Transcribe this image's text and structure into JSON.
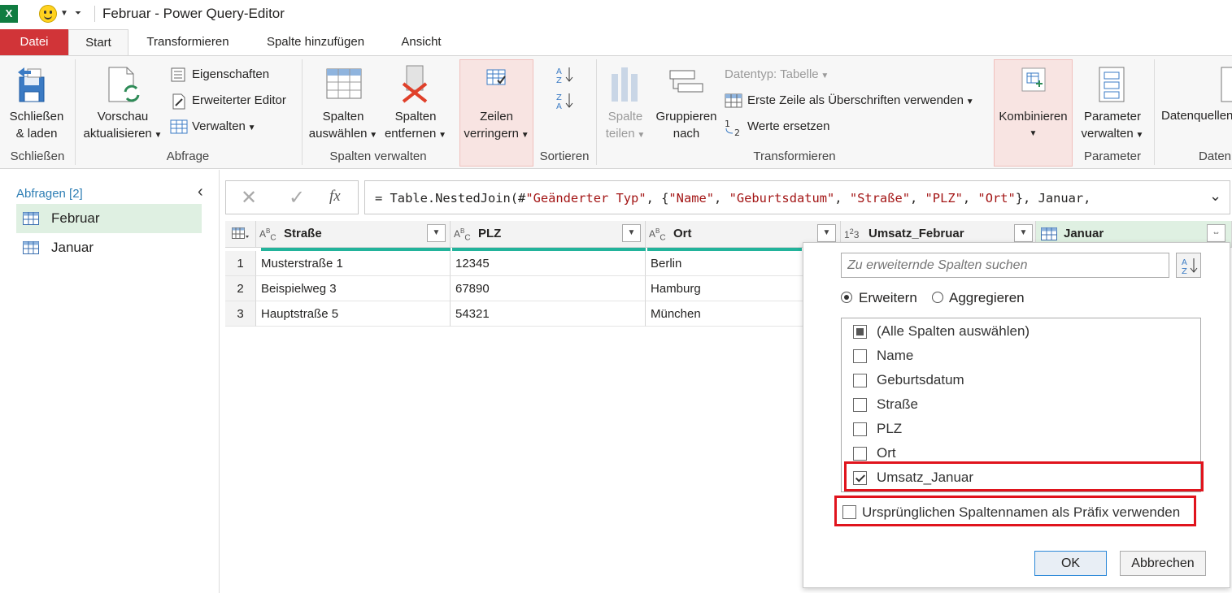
{
  "window": {
    "title": "Februar - Power Query-Editor",
    "app_logo": "X"
  },
  "tabs": [
    "Datei",
    "Start",
    "Transformieren",
    "Spalte hinzufügen",
    "Ansicht"
  ],
  "ribbon": {
    "close_load": {
      "line1": "Schließen",
      "line2": "& laden"
    },
    "refresh_preview": {
      "line1": "Vorschau",
      "line2": "aktualisieren"
    },
    "properties": "Eigenschaften",
    "advanced_editor": "Erweiterter Editor",
    "manage": "Verwalten",
    "choose_columns": {
      "line1": "Spalten",
      "line2": "auswählen"
    },
    "remove_columns": {
      "line1": "Spalten",
      "line2": "entfernen"
    },
    "reduce_rows": {
      "line1": "Zeilen",
      "line2": "verringern"
    },
    "split_column": {
      "line1": "Spalte",
      "line2": "teilen"
    },
    "group_by": {
      "line1": "Gruppieren",
      "line2": "nach"
    },
    "data_type": "Datentyp: Tabelle",
    "first_row_headers": "Erste Zeile als Überschriften verwenden",
    "replace_values": "Werte ersetzen",
    "combine": "Kombinieren",
    "manage_parameters": {
      "line1": "Parameter",
      "line2": "verwalten"
    },
    "data_sources": "Datenquellen",
    "groups": {
      "close": "Schließen",
      "query": "Abfrage",
      "manage_columns": "Spalten verwalten",
      "sort": "Sortieren",
      "transform": "Transformieren",
      "parameters": "Parameter",
      "data": "Daten"
    }
  },
  "queries": {
    "header": "Abfragen [2]",
    "items": [
      "Februar",
      "Januar"
    ]
  },
  "formula": {
    "fx": "fx",
    "prefix": "= Table.NestedJoin(#",
    "parts": [
      "\"Geänderter Typ\"",
      ", {",
      "\"Name\"",
      ", ",
      "\"Geburtsdatum\"",
      ", ",
      "\"Straße\"",
      ", ",
      "\"PLZ\"",
      ", ",
      "\"Ort\"",
      "}, Januar,"
    ]
  },
  "grid": {
    "columns": [
      {
        "type": "ABC",
        "name": "Straße"
      },
      {
        "type": "ABC",
        "name": "PLZ"
      },
      {
        "type": "ABC",
        "name": "Ort"
      },
      {
        "type": "123",
        "name": "Umsatz_Februar"
      },
      {
        "type": "table",
        "name": "Januar"
      }
    ],
    "rows": [
      {
        "n": "1",
        "strasse": "Musterstraße 1",
        "plz": "12345",
        "ort": "Berlin"
      },
      {
        "n": "2",
        "strasse": "Beispielweg 3",
        "plz": "67890",
        "ort": "Hamburg"
      },
      {
        "n": "3",
        "strasse": "Hauptstraße 5",
        "plz": "54321",
        "ort": "München"
      }
    ]
  },
  "expand_popup": {
    "search_placeholder": "Zu erweiternde Spalten suchen",
    "mode_expand": "Erweitern",
    "mode_aggregate": "Aggregieren",
    "selected_mode": "Erweitern",
    "columns": [
      {
        "label": "(Alle Spalten auswählen)",
        "state": "partial"
      },
      {
        "label": "Name",
        "state": "unchecked"
      },
      {
        "label": "Geburtsdatum",
        "state": "unchecked"
      },
      {
        "label": "Straße",
        "state": "unchecked"
      },
      {
        "label": "PLZ",
        "state": "unchecked"
      },
      {
        "label": "Ort",
        "state": "unchecked"
      },
      {
        "label": "Umsatz_Januar",
        "state": "checked"
      }
    ],
    "prefix_option": {
      "label": "Ursprünglichen Spaltennamen als Präfix verwenden",
      "checked": false
    },
    "ok": "OK",
    "cancel": "Abbrechen"
  },
  "colors": {
    "file_tab": "#d13438",
    "accent_teal": "#22b39b",
    "selected_query": "#dff0e2",
    "highlight_box": "#e0141d",
    "excel_green": "#107c41"
  }
}
